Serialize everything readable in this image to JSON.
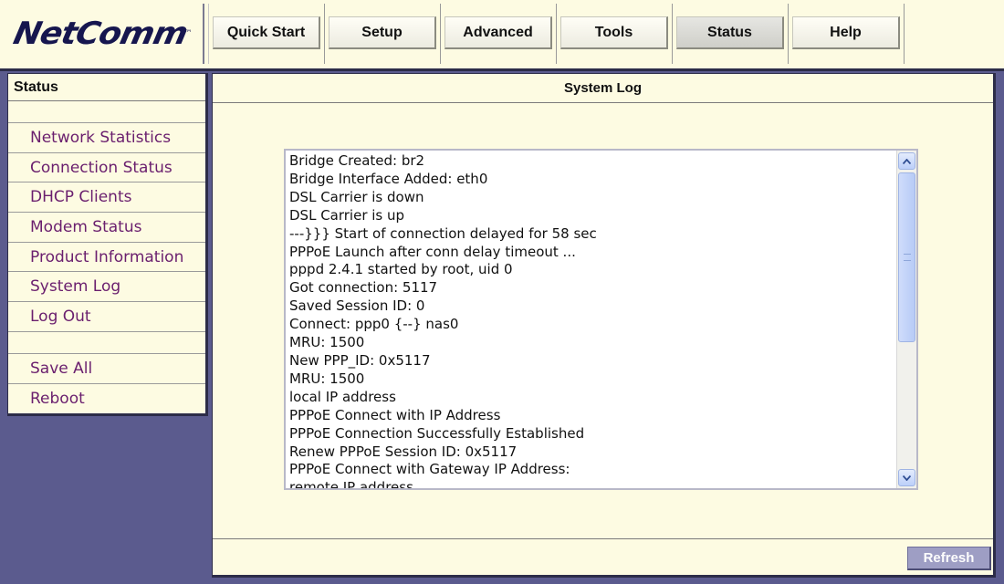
{
  "brand": {
    "logo": "NetComm",
    "trademark": "™"
  },
  "menu": [
    {
      "label": "Quick Start",
      "active": false
    },
    {
      "label": "Setup",
      "active": false
    },
    {
      "label": "Advanced",
      "active": false
    },
    {
      "label": "Tools",
      "active": false
    },
    {
      "label": "Status",
      "active": true
    },
    {
      "label": "Help",
      "active": false
    }
  ],
  "sidebar": {
    "title": "Status",
    "items": [
      "Network Statistics",
      "Connection Status",
      "DHCP Clients",
      "Modem Status",
      "Product Information",
      "System Log",
      "Log Out"
    ],
    "actions": [
      "Save All",
      "Reboot"
    ]
  },
  "main": {
    "title": "System Log",
    "log_lines": [
      "Bridge Created: br2",
      "Bridge Interface Added: eth0",
      "DSL Carrier is down",
      "DSL Carrier is up",
      "---}}} Start of connection delayed for 58 sec",
      "PPPoE Launch after conn delay timeout ...",
      "pppd 2.4.1 started by root, uid 0",
      "Got connection: 5117",
      "Saved Session ID: 0",
      "Connect: ppp0 {--} nas0",
      "MRU: 1500",
      "New PPP_ID: 0x5117",
      "MRU: 1500",
      "local  IP address",
      "PPPoE Connect with IP Address",
      "PPPoE Connection Successfully Established",
      "Renew PPPoE Session ID: 0x5117",
      "PPPoE Connect with Gateway IP Address:",
      "remote IP address"
    ],
    "refresh_label": "Refresh"
  },
  "icons": {
    "scroll_up": "chevron-up-icon",
    "scroll_down": "chevron-down-icon"
  },
  "colors": {
    "background": "#5b5b8e",
    "panel": "#fdfbe2",
    "link": "#6a1f6e",
    "logo": "#16164e",
    "refresh_button": "#9e9ec4"
  }
}
